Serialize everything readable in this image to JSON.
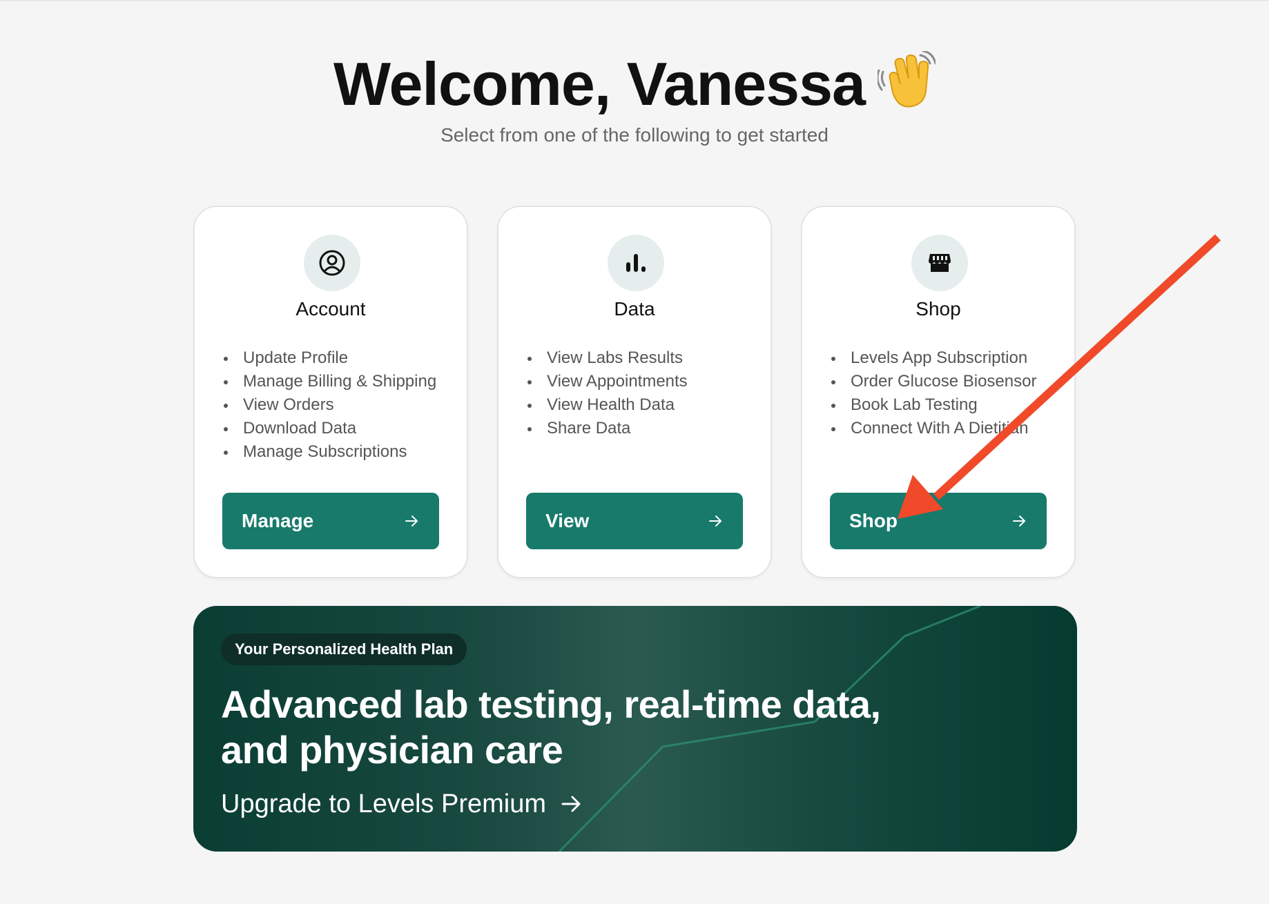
{
  "header": {
    "title": "Welcome, Vanessa",
    "subtitle": "Select from one of the following to get started"
  },
  "cards": [
    {
      "title": "Account",
      "icon": "user-circle-icon",
      "items": [
        "Update Profile",
        "Manage Billing & Shipping",
        "View Orders",
        "Download Data",
        "Manage Subscriptions"
      ],
      "button_label": "Manage"
    },
    {
      "title": "Data",
      "icon": "bar-chart-icon",
      "items": [
        "View Labs Results",
        "View Appointments",
        "View Health Data",
        "Share Data"
      ],
      "button_label": "View"
    },
    {
      "title": "Shop",
      "icon": "storefront-icon",
      "items": [
        "Levels App Subscription",
        "Order Glucose Biosensor",
        "Book Lab Testing",
        "Connect With A Dietitian"
      ],
      "button_label": "Shop"
    }
  ],
  "banner": {
    "pill": "Your Personalized Health Plan",
    "headline_line1": "Advanced lab testing, real-time data,",
    "headline_line2": "and physician care",
    "cta": "Upgrade to Levels Premium"
  },
  "colors": {
    "accent": "#177a6b",
    "banner_dark": "#0a3d33",
    "annotation_arrow": "#f04a2a",
    "icon_bg": "#e5eeec"
  }
}
